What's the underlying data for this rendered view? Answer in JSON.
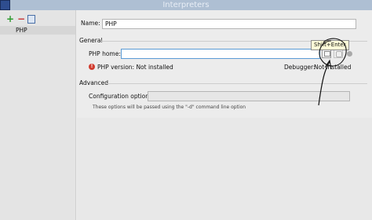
{
  "window": {
    "title": "Interpreters"
  },
  "sidebar": {
    "toolbar": {
      "add_icon": "+",
      "remove_icon": "−"
    },
    "items": [
      {
        "label": "PHP"
      }
    ]
  },
  "form": {
    "name_label": "Name:",
    "name_value": "PHP",
    "general_label": "General",
    "php_home_label": "PHP home:",
    "php_home_value": "",
    "tooltip": "Shift+Enter",
    "php_version_text": "PHP version: Not installed",
    "debugger_label": "Debugger:",
    "debugger_value": "Not installed",
    "advanced_label": "Advanced",
    "config_label": "Configuration options:",
    "config_value": "",
    "config_hint": "These options will be passed using the \"-d\" command line option"
  },
  "colors": {
    "accent": "#5b9bd5",
    "error": "#d13b2e",
    "titlebar": "#aebfd3",
    "annotation": "#111111"
  }
}
